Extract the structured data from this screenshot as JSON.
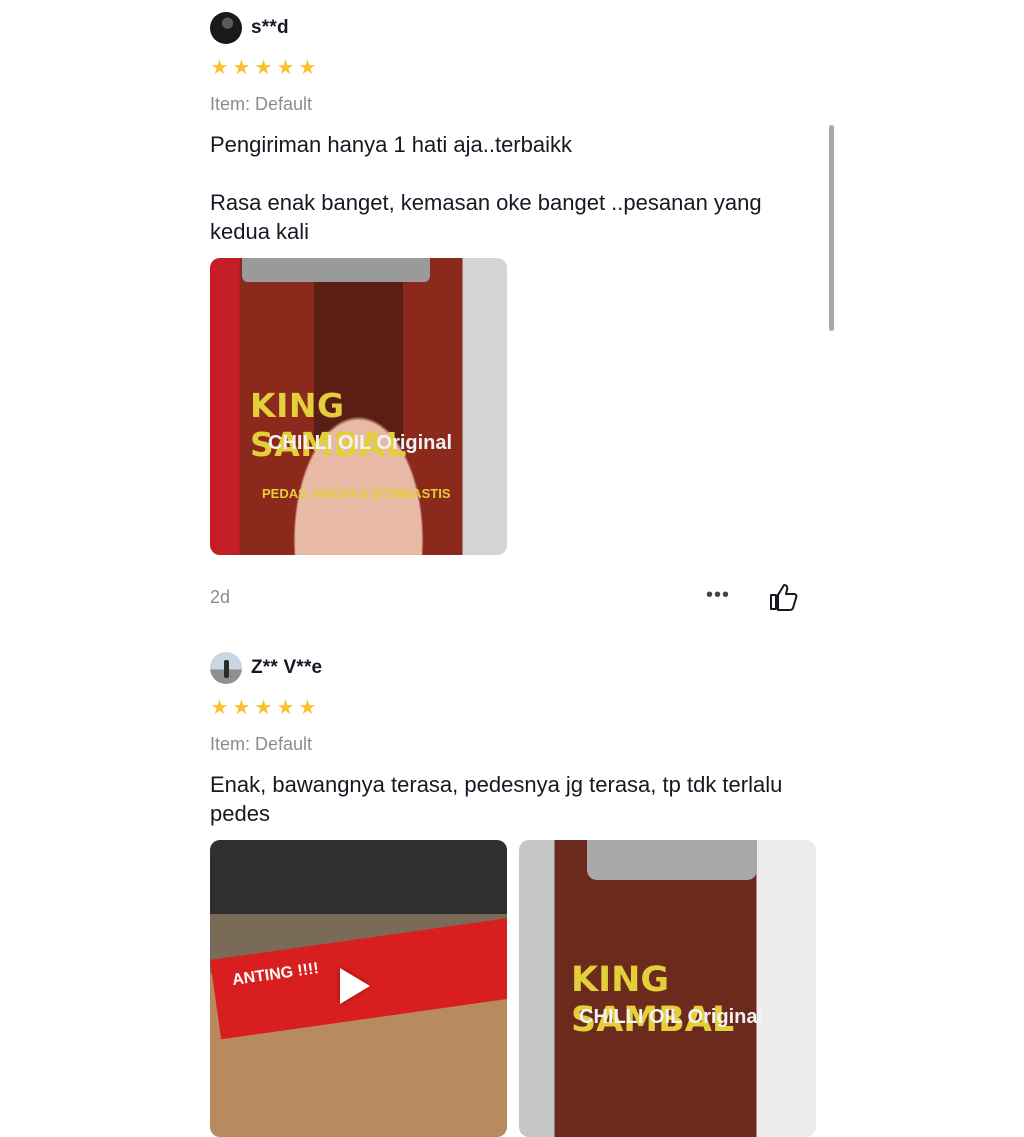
{
  "reviews": [
    {
      "username": "s**d",
      "rating": 5,
      "stars": [
        "★",
        "★",
        "★",
        "★",
        "★"
      ],
      "item": "Item: Default",
      "text": "Pengiriman hanya 1 hati aja..terbaikk\n\nRasa enak banget, kemasan oke banget ..pesanan yang kedua kali",
      "photo_labels": {
        "brand": "KING SAMBAL",
        "product": "CHILLI OIL Original",
        "tagline": "PEDAS, NAGIH & BOMBASTIS"
      },
      "date": "2d",
      "more_icon": "more-horizontal-icon",
      "like_icon": "thumbs-up-icon"
    },
    {
      "username": "Z** V**e",
      "rating": 5,
      "stars": [
        "★",
        "★",
        "★",
        "★",
        "★"
      ],
      "item": "Item: Default",
      "text": "Enak, bawangnya terasa, pedesnya jg terasa, tp tdk terlalu pedes",
      "photo_labels": {
        "tape": "ANTING !!!!",
        "brand": "KING SAMBAL",
        "product": "CHILLI OIL Original"
      }
    }
  ],
  "colors": {
    "star": "#fbc02d",
    "secondary_text": "#8a8b91",
    "primary_text": "#161823"
  }
}
